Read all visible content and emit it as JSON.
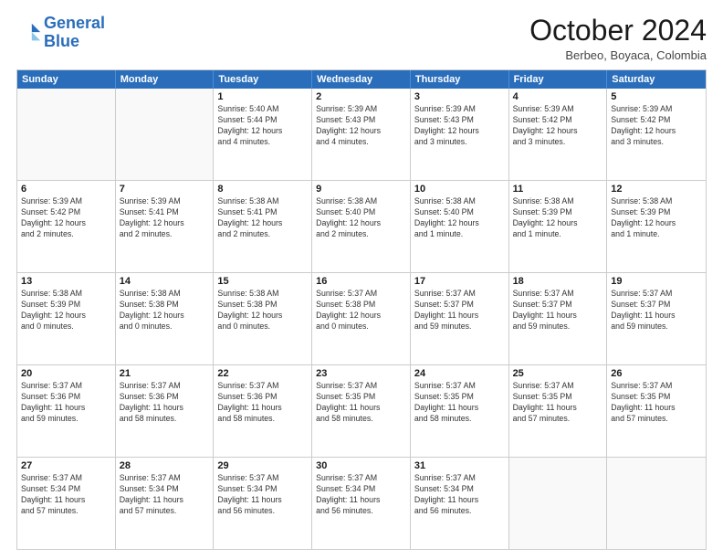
{
  "header": {
    "logo_line1": "General",
    "logo_line2": "Blue",
    "month_title": "October 2024",
    "location": "Berbeo, Boyaca, Colombia"
  },
  "days_of_week": [
    "Sunday",
    "Monday",
    "Tuesday",
    "Wednesday",
    "Thursday",
    "Friday",
    "Saturday"
  ],
  "weeks": [
    [
      {
        "day": "",
        "content": ""
      },
      {
        "day": "",
        "content": ""
      },
      {
        "day": "1",
        "content": "Sunrise: 5:40 AM\nSunset: 5:44 PM\nDaylight: 12 hours\nand 4 minutes."
      },
      {
        "day": "2",
        "content": "Sunrise: 5:39 AM\nSunset: 5:43 PM\nDaylight: 12 hours\nand 4 minutes."
      },
      {
        "day": "3",
        "content": "Sunrise: 5:39 AM\nSunset: 5:43 PM\nDaylight: 12 hours\nand 3 minutes."
      },
      {
        "day": "4",
        "content": "Sunrise: 5:39 AM\nSunset: 5:42 PM\nDaylight: 12 hours\nand 3 minutes."
      },
      {
        "day": "5",
        "content": "Sunrise: 5:39 AM\nSunset: 5:42 PM\nDaylight: 12 hours\nand 3 minutes."
      }
    ],
    [
      {
        "day": "6",
        "content": "Sunrise: 5:39 AM\nSunset: 5:42 PM\nDaylight: 12 hours\nand 2 minutes."
      },
      {
        "day": "7",
        "content": "Sunrise: 5:39 AM\nSunset: 5:41 PM\nDaylight: 12 hours\nand 2 minutes."
      },
      {
        "day": "8",
        "content": "Sunrise: 5:38 AM\nSunset: 5:41 PM\nDaylight: 12 hours\nand 2 minutes."
      },
      {
        "day": "9",
        "content": "Sunrise: 5:38 AM\nSunset: 5:40 PM\nDaylight: 12 hours\nand 2 minutes."
      },
      {
        "day": "10",
        "content": "Sunrise: 5:38 AM\nSunset: 5:40 PM\nDaylight: 12 hours\nand 1 minute."
      },
      {
        "day": "11",
        "content": "Sunrise: 5:38 AM\nSunset: 5:39 PM\nDaylight: 12 hours\nand 1 minute."
      },
      {
        "day": "12",
        "content": "Sunrise: 5:38 AM\nSunset: 5:39 PM\nDaylight: 12 hours\nand 1 minute."
      }
    ],
    [
      {
        "day": "13",
        "content": "Sunrise: 5:38 AM\nSunset: 5:39 PM\nDaylight: 12 hours\nand 0 minutes."
      },
      {
        "day": "14",
        "content": "Sunrise: 5:38 AM\nSunset: 5:38 PM\nDaylight: 12 hours\nand 0 minutes."
      },
      {
        "day": "15",
        "content": "Sunrise: 5:38 AM\nSunset: 5:38 PM\nDaylight: 12 hours\nand 0 minutes."
      },
      {
        "day": "16",
        "content": "Sunrise: 5:37 AM\nSunset: 5:38 PM\nDaylight: 12 hours\nand 0 minutes."
      },
      {
        "day": "17",
        "content": "Sunrise: 5:37 AM\nSunset: 5:37 PM\nDaylight: 11 hours\nand 59 minutes."
      },
      {
        "day": "18",
        "content": "Sunrise: 5:37 AM\nSunset: 5:37 PM\nDaylight: 11 hours\nand 59 minutes."
      },
      {
        "day": "19",
        "content": "Sunrise: 5:37 AM\nSunset: 5:37 PM\nDaylight: 11 hours\nand 59 minutes."
      }
    ],
    [
      {
        "day": "20",
        "content": "Sunrise: 5:37 AM\nSunset: 5:36 PM\nDaylight: 11 hours\nand 59 minutes."
      },
      {
        "day": "21",
        "content": "Sunrise: 5:37 AM\nSunset: 5:36 PM\nDaylight: 11 hours\nand 58 minutes."
      },
      {
        "day": "22",
        "content": "Sunrise: 5:37 AM\nSunset: 5:36 PM\nDaylight: 11 hours\nand 58 minutes."
      },
      {
        "day": "23",
        "content": "Sunrise: 5:37 AM\nSunset: 5:35 PM\nDaylight: 11 hours\nand 58 minutes."
      },
      {
        "day": "24",
        "content": "Sunrise: 5:37 AM\nSunset: 5:35 PM\nDaylight: 11 hours\nand 58 minutes."
      },
      {
        "day": "25",
        "content": "Sunrise: 5:37 AM\nSunset: 5:35 PM\nDaylight: 11 hours\nand 57 minutes."
      },
      {
        "day": "26",
        "content": "Sunrise: 5:37 AM\nSunset: 5:35 PM\nDaylight: 11 hours\nand 57 minutes."
      }
    ],
    [
      {
        "day": "27",
        "content": "Sunrise: 5:37 AM\nSunset: 5:34 PM\nDaylight: 11 hours\nand 57 minutes."
      },
      {
        "day": "28",
        "content": "Sunrise: 5:37 AM\nSunset: 5:34 PM\nDaylight: 11 hours\nand 57 minutes."
      },
      {
        "day": "29",
        "content": "Sunrise: 5:37 AM\nSunset: 5:34 PM\nDaylight: 11 hours\nand 56 minutes."
      },
      {
        "day": "30",
        "content": "Sunrise: 5:37 AM\nSunset: 5:34 PM\nDaylight: 11 hours\nand 56 minutes."
      },
      {
        "day": "31",
        "content": "Sunrise: 5:37 AM\nSunset: 5:34 PM\nDaylight: 11 hours\nand 56 minutes."
      },
      {
        "day": "",
        "content": ""
      },
      {
        "day": "",
        "content": ""
      }
    ]
  ]
}
